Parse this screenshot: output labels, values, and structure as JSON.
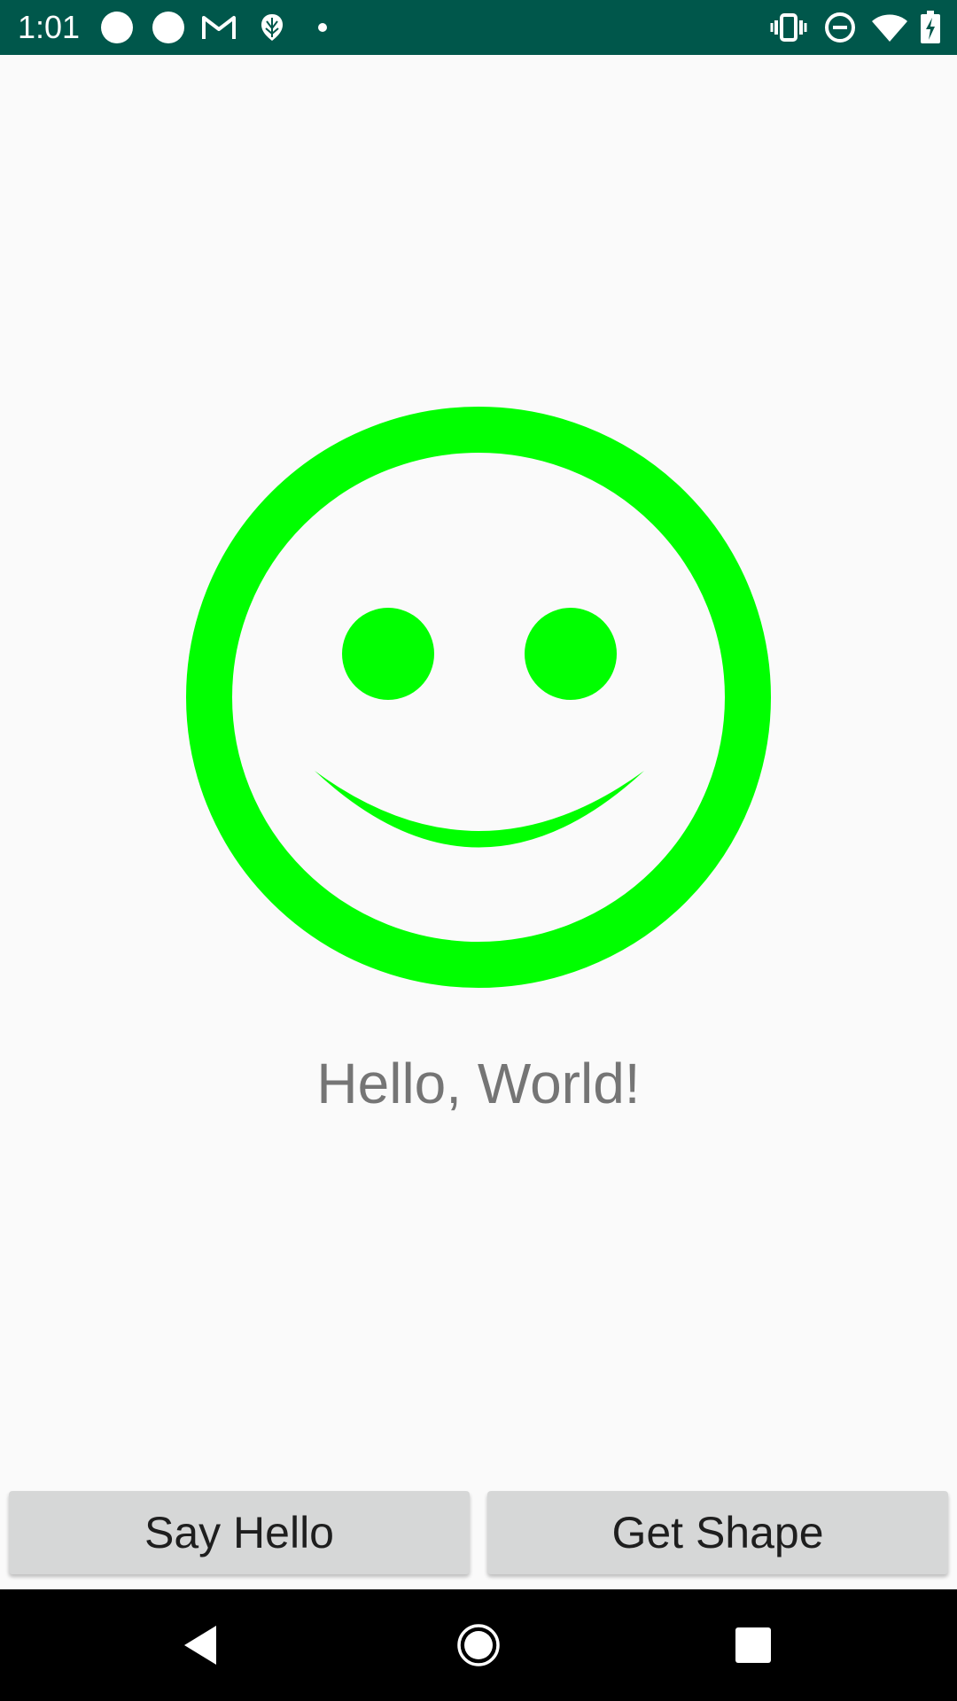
{
  "status_bar": {
    "time": "1:01",
    "background": "#00574b",
    "left_icons": [
      "circle-notification-icon",
      "circle-notification-icon",
      "gmail-icon",
      "app-notification-icon",
      "more-dot-icon"
    ],
    "right_icons": [
      "vibrate-icon",
      "do-not-disturb-icon",
      "wifi-icon",
      "battery-charging-icon"
    ]
  },
  "main": {
    "image": {
      "icon": "smiley-face-icon",
      "color": "#00ff00"
    },
    "message": "Hello, World!"
  },
  "buttons": {
    "say_hello": "Say Hello",
    "get_shape": "Get Shape"
  },
  "nav_bar": {
    "icons": [
      "back-icon",
      "home-icon",
      "recents-icon"
    ]
  }
}
